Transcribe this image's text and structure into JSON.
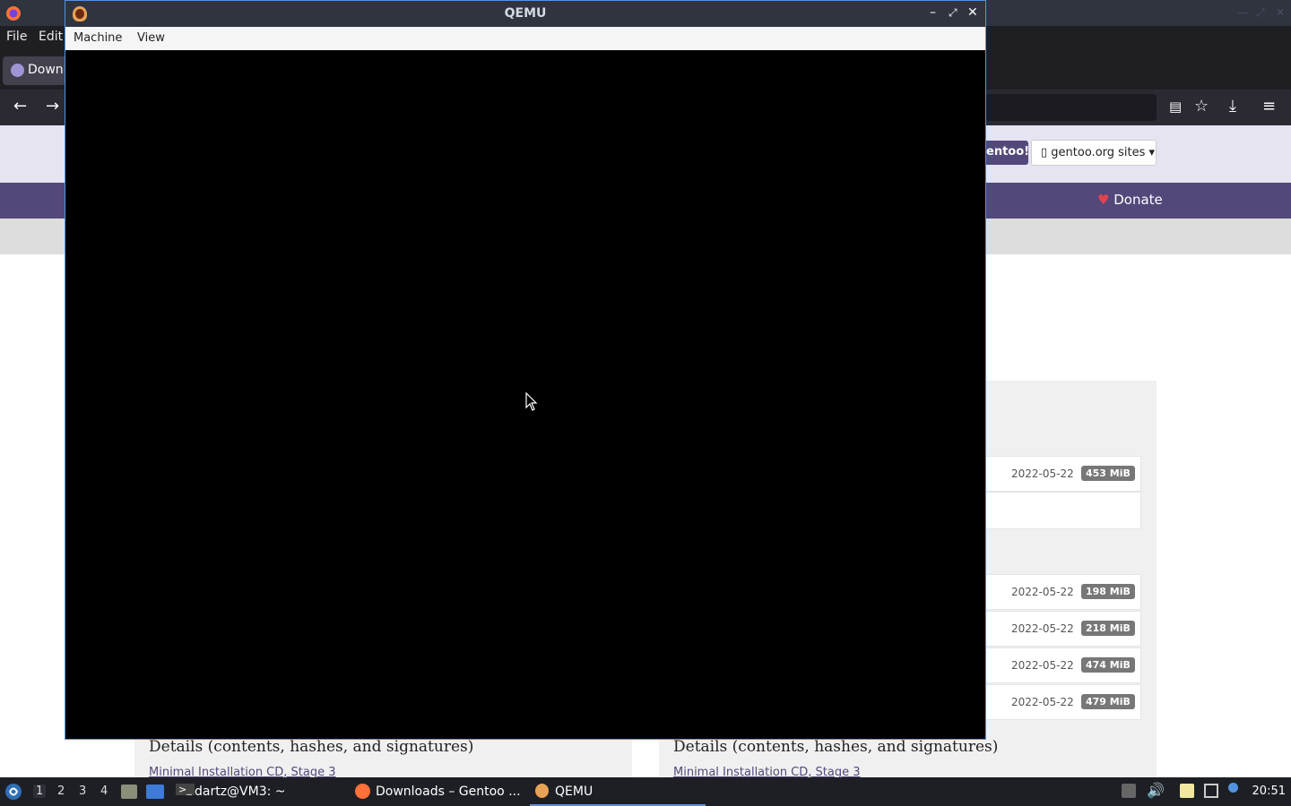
{
  "firefox": {
    "menu": [
      "File",
      "Edit"
    ],
    "tab_label": "Downl",
    "header": {
      "get_gentoo": "entoo!",
      "sites_button": "gentoo.org sites ▾",
      "donate": "Donate"
    },
    "downloads": [
      {
        "date": "2022-05-22",
        "size": "453 MiB"
      },
      {
        "date": "2022-05-22",
        "size": "198 MiB"
      },
      {
        "date": "2022-05-22",
        "size": "218 MiB"
      },
      {
        "date": "2022-05-22",
        "size": "474 MiB"
      },
      {
        "date": "2022-05-22",
        "size": "479 MiB"
      }
    ],
    "details_title": "Details (contents, hashes, and signatures)",
    "details_link": "Minimal Installation CD, Stage 3"
  },
  "qemu": {
    "title": "QEMU",
    "menu": [
      "Machine",
      "View"
    ]
  },
  "taskbar": {
    "workspaces": [
      "1",
      "2",
      "3",
      "4"
    ],
    "items": [
      "dartz@VM3: ~",
      "Downloads – Gentoo ...",
      "QEMU"
    ],
    "clock": "20:51"
  }
}
